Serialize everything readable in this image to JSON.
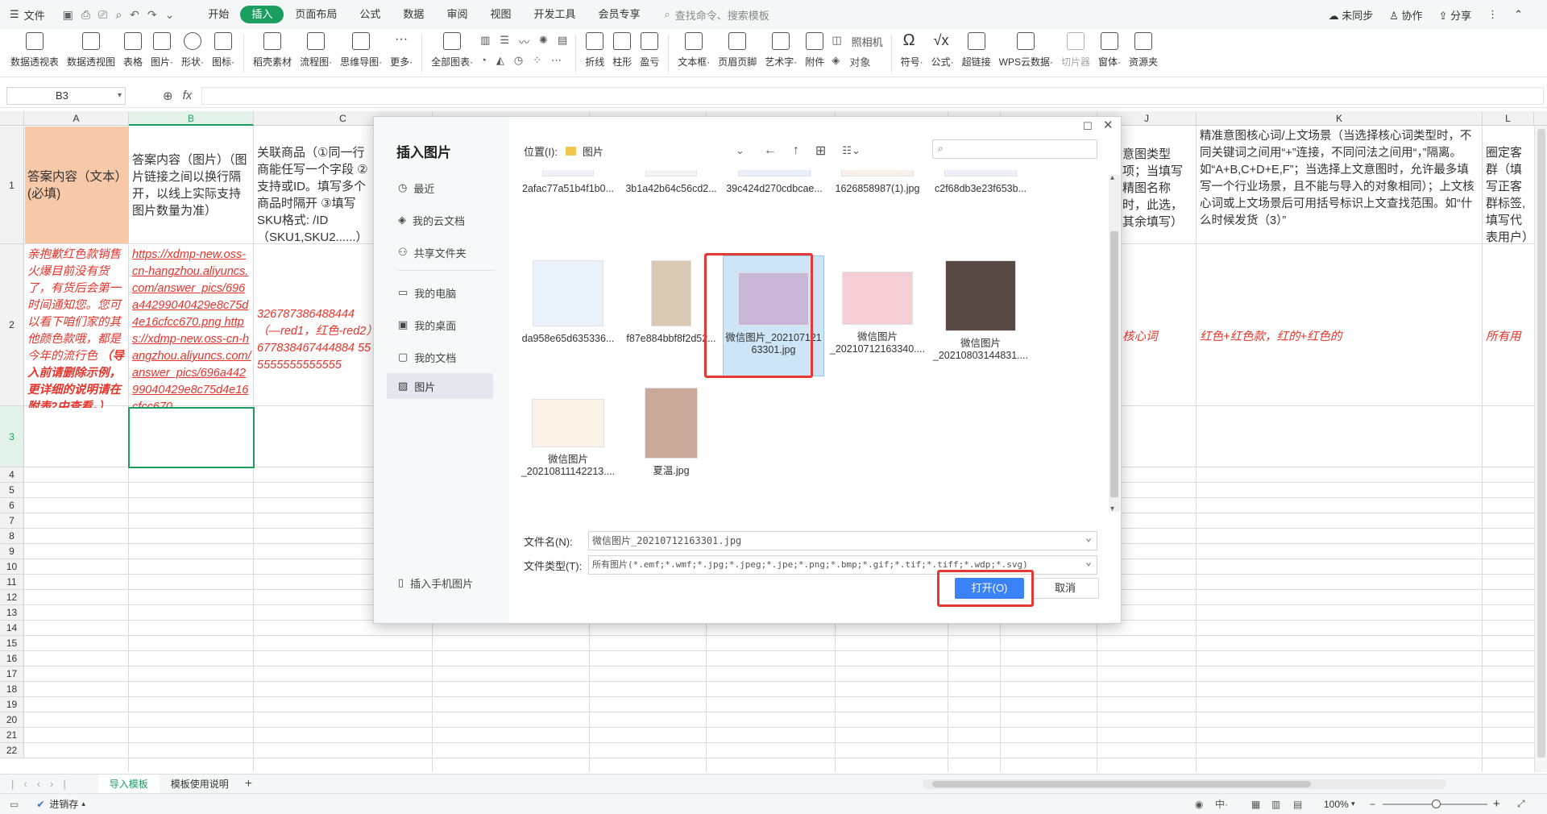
{
  "menubar": {
    "file_label": "文件",
    "tabs": [
      {
        "label": "开始",
        "active": false
      },
      {
        "label": "插入",
        "active": true
      },
      {
        "label": "页面布局",
        "active": false
      },
      {
        "label": "公式",
        "active": false
      },
      {
        "label": "数据",
        "active": false
      },
      {
        "label": "审阅",
        "active": false
      },
      {
        "label": "视图",
        "active": false
      },
      {
        "label": "开发工具",
        "active": false
      },
      {
        "label": "会员专享",
        "active": false
      }
    ],
    "search": "查找命令、搜索模板",
    "right": [
      "未同步",
      "协作",
      "分享"
    ]
  },
  "ribbon": {
    "items": [
      "数据透视表",
      "数据透视图",
      "表格",
      "图片·",
      "形状·",
      "图标·",
      "稻壳素材",
      "流程图·",
      "思维导图·",
      "更多·",
      "全部图表·",
      "折线",
      "柱形",
      "盈亏",
      "文本框·",
      "页眉页脚",
      "艺术字·",
      "附件",
      "对象",
      "符号·",
      "公式·",
      "超链接",
      "WPS云数据·",
      "切片器",
      "窗体·",
      "资源夹"
    ],
    "mini": [
      "照相机"
    ]
  },
  "formula": {
    "cell_ref": "B3",
    "fx": "fx"
  },
  "sheet": {
    "columns": [
      "A",
      "B",
      "C",
      "J",
      "K",
      "L"
    ],
    "rows": [
      "1",
      "2",
      "3",
      "4",
      "5",
      "6",
      "7",
      "8",
      "9",
      "10",
      "11",
      "12",
      "13",
      "14",
      "15",
      "16",
      "17",
      "18",
      "19",
      "20",
      "21",
      "22"
    ],
    "a1": "答案内容（文本）(必填)",
    "b1": "答案内容（图片）（图片链接之间以换行隔开，以线上实际支持图片数量为准）",
    "c1": "关联商品（①同一行商能任写一个字段 ②支持或ID。填写多个商品时隔开 ③填写SKU格式: /ID（SKU1,SKU2......）",
    "j1": "意图类型项；当填写精图名称时，此选，其余填写）",
    "k1": "精准意图核心词/上文场景（当选择核心词类型时，不同关键词之间用“+”连接，不同问法之间用“，”隔离。如“A+B,C+D+E,F”；当选择上文意图时，允许最多填写一个行业场景，且不能与导入的对象相同）；上文核心词或上文场景后可用括号标识上文查找范围。如“什么时候发货（3）”",
    "l1": "圈定客群（填写正客群标签,填写代表用户）",
    "a2": "亲抱歉红色款销售火爆目前没有货了，有货后会第一时间通知您。您可以看下咱们家的其他颜色款哦，都是今年的流行色",
    "a2_bold": "（导入前请删除示例，更详细的说明请在附表2中查看。）",
    "b2": "https://xdmp-new.oss-cn-hangzhou.aliyuncs.com/answer_pics/696a44299040429e8c75d4e16cfcc670.png https://xdmp-new.oss-cn-hangzhou.aliyuncs.com/answer_pics/696a44299040429e8c75d4e16cfcc670",
    "c2": "326787386488444（—red1，红色-red2）677838467444884 555555555555555",
    "j2": "核心词",
    "k2": "红色+红色款，红的+红色的",
    "l2": "所有用户"
  },
  "sheet_tabs": [
    "导入模板",
    "模板使用说明"
  ],
  "status": {
    "left": "进销存",
    "zoom": "100%"
  },
  "dialog": {
    "title": "插入图片",
    "nav": [
      "最近",
      "我的云文档",
      "共享文件夹",
      "我的电脑",
      "我的桌面",
      "我的文档",
      "图片"
    ],
    "nav_active": "图片",
    "mobile": "插入手机图片",
    "location_label": "位置(I):",
    "location": "图片",
    "files": [
      {
        "name": "2afac77a51b4f1b0..."
      },
      {
        "name": "3b1a42b64c56cd2..."
      },
      {
        "name": "39c424d270cdbcae..."
      },
      {
        "name": "1626858987(1).jpg"
      },
      {
        "name": "c2f68db3e23f653b..."
      },
      {
        "name": "da958e65d635336..."
      },
      {
        "name": "f87e884bbf8f2d52..."
      },
      {
        "name": "微信图片_20210712163301.jpg"
      },
      {
        "name": "微信图片_20210712163340...."
      },
      {
        "name": "微信图片_20210803144831...."
      },
      {
        "name": "微信图片_20210811142213...."
      },
      {
        "name": "夏温.jpg"
      }
    ],
    "filename_label": "文件名(N):",
    "filename": "微信图片_20210712163301.jpg",
    "filetype_label": "文件类型(T):",
    "filetype": "所有图片(*.emf;*.wmf;*.jpg;*.jpeg;*.jpe;*.png;*.bmp;*.gif;*.tif;*.tiff;*.wdp;*.svg)",
    "open": "打开(O)",
    "cancel": "取消"
  }
}
